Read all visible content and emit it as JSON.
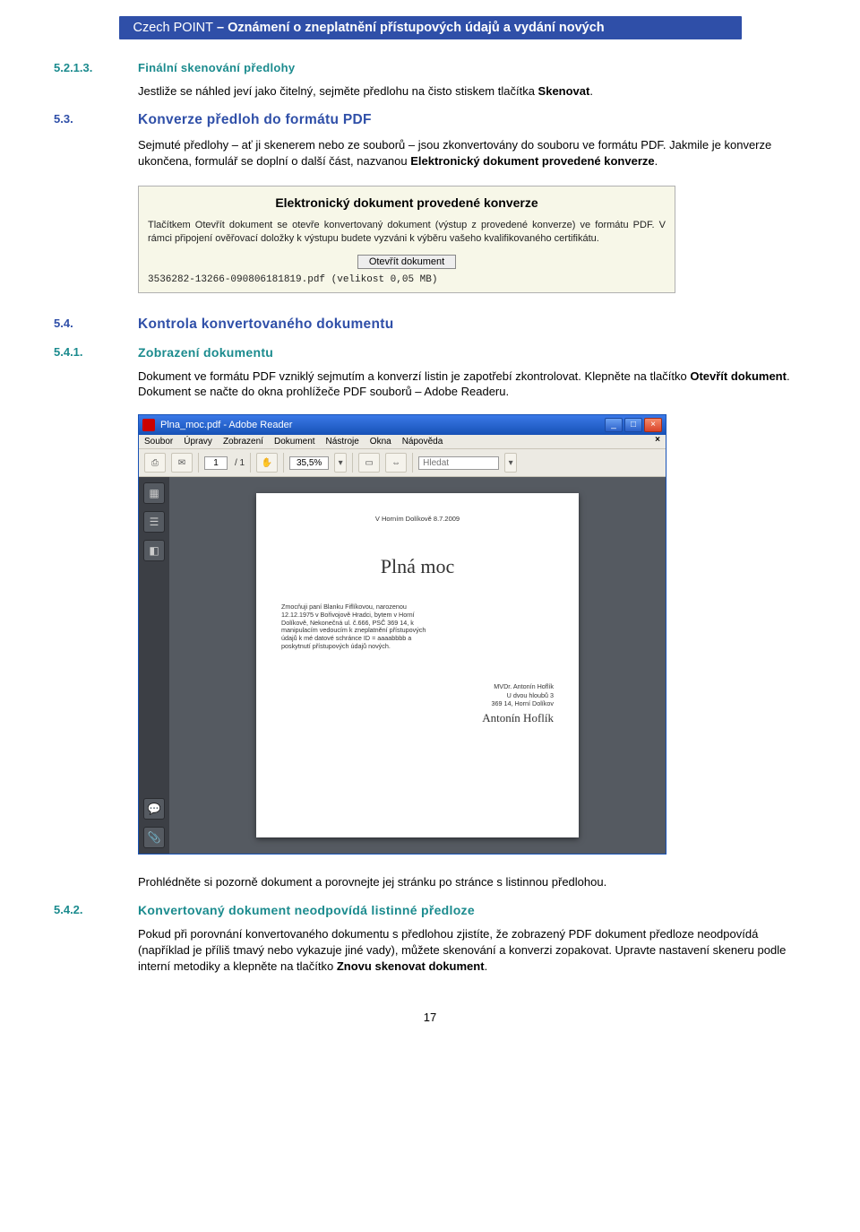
{
  "header": {
    "left": "Czech POINT",
    "right": "Oznámení o zneplatnění přístupových údajů a vydání nových"
  },
  "s5213": {
    "num": "5.2.1.3.",
    "title": "Finální skenování předlohy",
    "p": "Jestliže se náhled jeví jako čitelný, sejměte předlohu na čisto stiskem tlačítka ",
    "p_bold": "Skenovat",
    "p_end": "."
  },
  "s53": {
    "num": "5.3.",
    "title": "Konverze předloh do formátu PDF",
    "p1": "Sejmuté předlohy – ať ji skenerem nebo ze souborů – jsou zkonvertovány do souboru ve formátu PDF. Jakmile je konverze ukončena, formulář se doplní o další část, nazvanou ",
    "p1_bold": "Elektronický dokument provedené konverze",
    "p1_end": "."
  },
  "konvbox": {
    "title": "Elektronický dokument provedené konverze",
    "body": "Tlačítkem Otevřít dokument se otevře konvertovaný dokument (výstup z provedené konverze) ve formátu PDF. V rámci připojení ověřovací doložky k výstupu budete vyzváni k výběru vašeho kvalifikovaného certifikátu.",
    "button": "Otevřít dokument",
    "file": "3536282-13266-090806181819.pdf (velikost 0,05 MB)"
  },
  "s54": {
    "num": "5.4.",
    "title": "Kontrola konvertovaného dokumentu"
  },
  "s541": {
    "num": "5.4.1.",
    "title": "Zobrazení dokumentu",
    "p1": "Dokument ve formátu PDF vzniklý sejmutím a konverzí listin je zapotřebí zkontrolovat. Klepněte na tlačítko ",
    "p1_bold": "Otevřít dokument",
    "p1_end": ". Dokument se načte do okna prohlížeče PDF souborů – Adobe Readeru."
  },
  "reader": {
    "title": "Plna_moc.pdf - Adobe Reader",
    "menu": [
      "Soubor",
      "Úpravy",
      "Zobrazení",
      "Dokument",
      "Nástroje",
      "Okna",
      "Nápověda"
    ],
    "menu_close": "×",
    "page_current": "1",
    "page_total": "/ 1",
    "zoom": "35,5%",
    "search_placeholder": "Hledat",
    "win_btns": {
      "min": "_",
      "max": "□",
      "close": "×"
    },
    "doc": {
      "date": "V Horním Dolíkově 8.7.2009",
      "title": "Plná moc",
      "body": "Zmocňuji paní Blanku Fiflíkovou, narozenou 12.12.1975 v Bořivojově Hradci, bytem v Horní Dolíkově, Nekonečná ul. č.666, PSČ 369 14, k manipulacím vedoucím k zneplatnění přístupových údajů k mé datové schránce ID = aaaabbbb a poskytnutí přístupových údajů nových.",
      "sign_name": "MVDr. Antonín Hoflík",
      "sign_addr1": "U dvou hloubů 3",
      "sign_addr2": "369 14, Horní Dolíkov",
      "sign_script": "Antonín Hoflík"
    }
  },
  "post_reader": {
    "p": "Prohlédněte si pozorně dokument a porovnejte jej stránku po stránce s listinnou předlohou."
  },
  "s542": {
    "num": "5.4.2.",
    "title": "Konvertovaný dokument neodpovídá listinné předloze",
    "p1a": "Pokud při porovnání konvertovaného dokumentu s předlohou zjistíte, že zobrazený PDF dokument předloze neodpovídá (například je příliš tmavý nebo vykazuje jiné vady), můžete skenování a konverzi zopakovat. Upravte nastavení skeneru podle interní metodiky a klepněte na tlačítko ",
    "p1_bold": "Znovu skenovat dokument",
    "p1_end": "."
  },
  "page_number": "17"
}
